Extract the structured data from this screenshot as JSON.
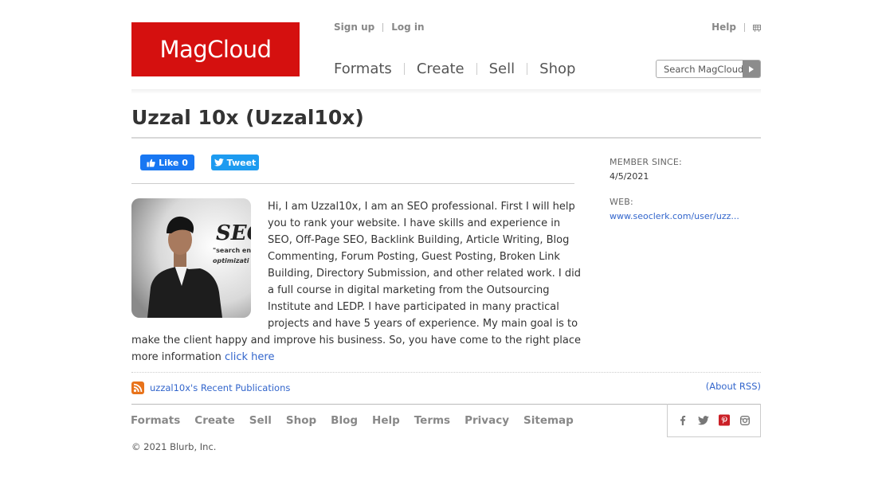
{
  "header": {
    "logo_text": "MagCloud",
    "logo_color": "#d5100f",
    "signup": "Sign up",
    "login": "Log in",
    "help": "Help",
    "nav": [
      "Formats",
      "Create",
      "Sell",
      "Shop"
    ],
    "search_placeholder": "Search MagCloud"
  },
  "profile": {
    "title": "Uzzal 10x (Uzzal10x)",
    "like_label": "Like 0",
    "tweet_label": "Tweet",
    "bio_text": "Hi, I am Uzzal10x, I am an SEO professional. First I will help you to rank your website. I have skills and experience in SEO, Off-Page SEO, Backlink Building, Article Writing, Blog Commenting, Forum Posting, Guest Posting, Broken Link Building, Directory Submission, and other related work. I did a full course in digital marketing from the Outsourcing Institute and LEDP. I have participated in many practical projects and have 5 years of experience. My main goal is to make the client happy and improve his business. So, you have come to the right place more information",
    "bio_link": "click here",
    "avatar_text_top": "SEO",
    "avatar_text_mid": "\"search en",
    "avatar_text_bot": "optimizati"
  },
  "sidebar": {
    "member_since_label": "MEMBER SINCE:",
    "member_since_value": "4/5/2021",
    "web_label": "WEB:",
    "web_value": "www.seoclerk.com/user/uzz..."
  },
  "publications": {
    "rss_link": "uzzal10x's Recent Publications",
    "about_rss_open": "(",
    "about_rss": "About RSS",
    "about_rss_close": ")"
  },
  "footer": {
    "nav": [
      "Formats",
      "Create",
      "Sell",
      "Shop",
      "Blog",
      "Help",
      "Terms",
      "Privacy",
      "Sitemap"
    ],
    "copyright": "© 2021 Blurb, Inc."
  }
}
